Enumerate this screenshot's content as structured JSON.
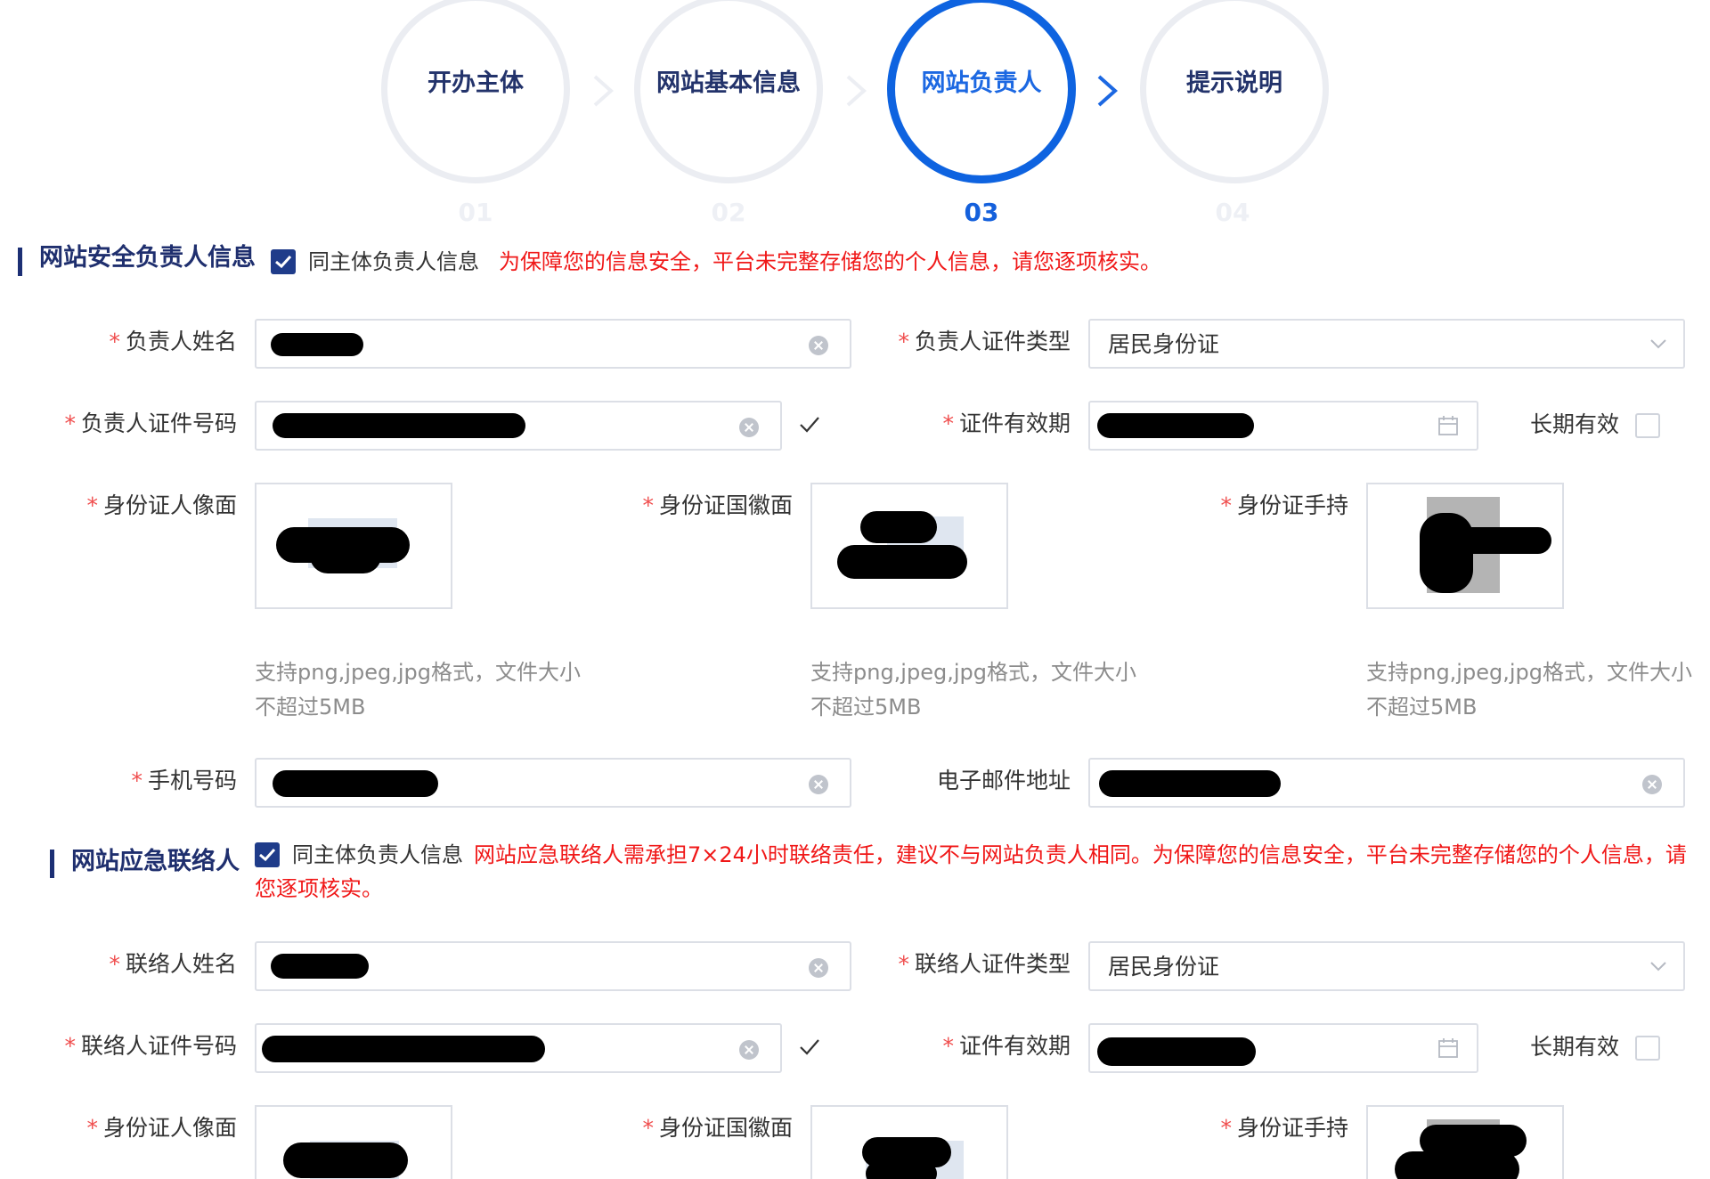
{
  "steps": [
    {
      "label": "开办主体",
      "number": "01",
      "active": false
    },
    {
      "label": "网站基本信息",
      "number": "02",
      "active": false
    },
    {
      "label": "网站负责人",
      "number": "03",
      "active": true
    },
    {
      "label": "提示说明",
      "number": "04",
      "active": false
    }
  ],
  "security": {
    "title": "网站安全负责人信息",
    "same_as_label": "同主体负责人信息",
    "same_as_checked": true,
    "notice": "为保障您的信息安全，平台未完整存储您的个人信息，请您逐项核实。",
    "name_label": "负责人姓名",
    "name_value": "",
    "id_type_label": "负责人证件类型",
    "id_type_value": "居民身份证",
    "id_number_label": "负责人证件号码",
    "id_number_value": "",
    "validity_label": "证件有效期",
    "validity_value": "",
    "long_term_label": "长期有效",
    "long_term_checked": false,
    "id_front_label": "身份证人像面",
    "id_back_label": "身份证国徽面",
    "id_hold_label": "身份证手持",
    "upload_hint": "支持png,jpeg,jpg格式，文件大小\n不超过5MB",
    "phone_label": "手机号码",
    "phone_value": "",
    "email_label": "电子邮件地址",
    "email_value": ""
  },
  "emergency": {
    "title": "网站应急联络人",
    "same_as_label": "同主体负责人信息",
    "same_as_checked": true,
    "notice": "网站应急联络人需承担7×24小时联络责任，建议不与网站负责人相同。为保障您的信息安全，平台未完整存储您的个人信息，请您逐项核实。",
    "name_label": "联络人姓名",
    "name_value": "",
    "id_type_label": "联络人证件类型",
    "id_type_value": "居民身份证",
    "id_number_label": "联络人证件号码",
    "id_number_value": "",
    "validity_label": "证件有效期",
    "validity_value": "",
    "long_term_label": "长期有效",
    "long_term_checked": false,
    "id_front_label": "身份证人像面",
    "id_back_label": "身份证国徽面",
    "id_hold_label": "身份证手持"
  },
  "required_mark": "*",
  "colors": {
    "accent": "#0e63e0",
    "title": "#1f2f6e",
    "warning": "#f01818",
    "required": "#f04d4d"
  }
}
